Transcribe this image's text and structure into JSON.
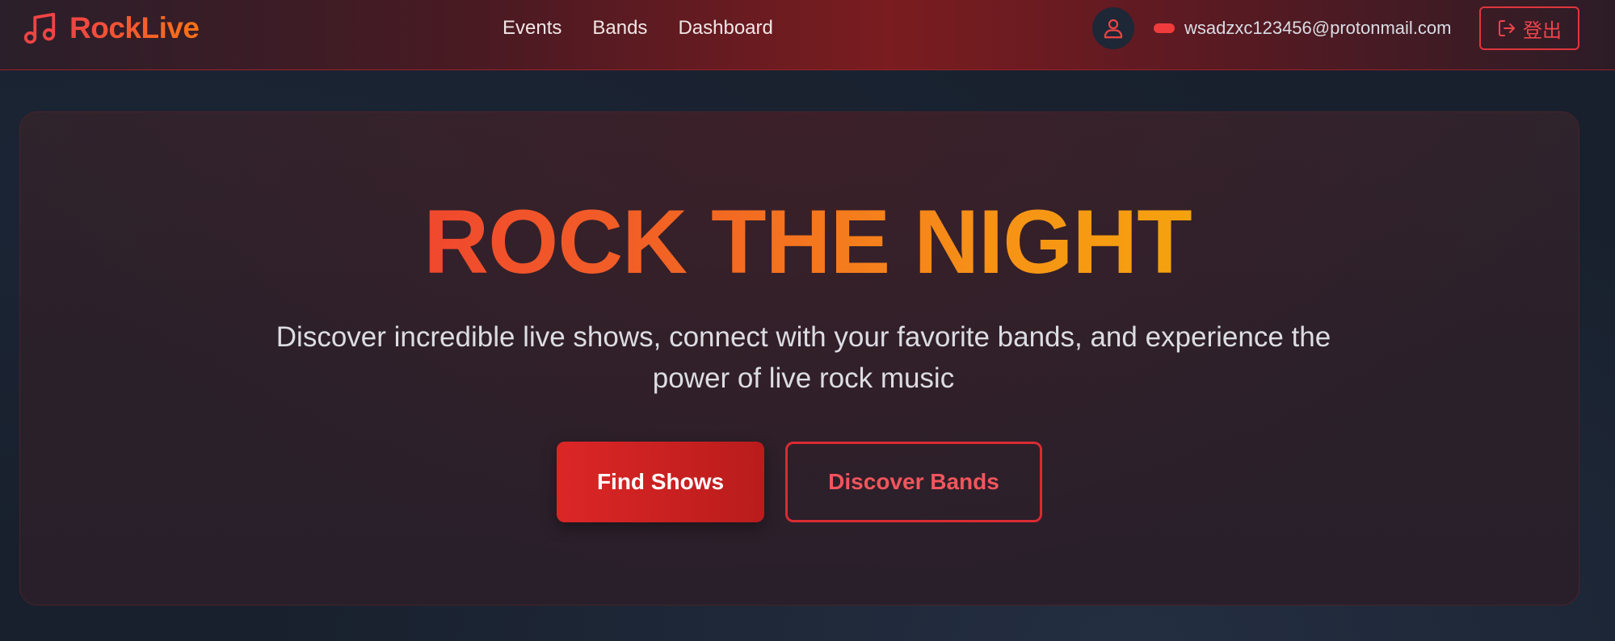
{
  "navbar": {
    "brand": "RockLive",
    "links": [
      {
        "label": "Events"
      },
      {
        "label": "Bands"
      },
      {
        "label": "Dashboard"
      }
    ],
    "user_email": "wsadzxc123456@protonmail.com",
    "logout_label": "登出",
    "icons": {
      "brand": "music-note-icon",
      "avatar": "user-icon",
      "logout": "log-out-icon"
    }
  },
  "hero": {
    "title": "ROCK THE NIGHT",
    "subtitle": "Discover incredible live shows, connect with your favorite bands, and experience the power of live rock music",
    "primary_button": "Find Shows",
    "secondary_button": "Discover Bands"
  },
  "colors": {
    "accent_red": "#dc2626",
    "accent_orange": "#f97316",
    "accent_amber": "#f59e0b",
    "background": "#18202d"
  }
}
